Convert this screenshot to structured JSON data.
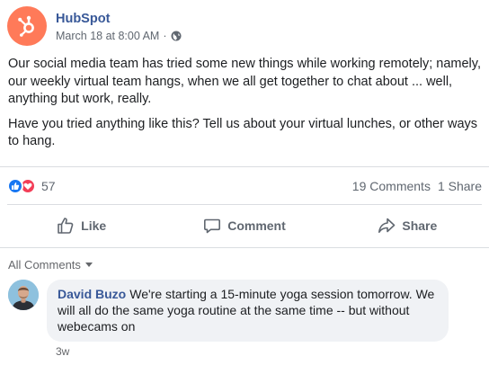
{
  "post": {
    "page_name": "HubSpot",
    "timestamp": "March 18 at 8:00 AM",
    "separator": "·",
    "privacy_icon": "globe-icon",
    "body_paragraph_1": "Our social media team has tried some new things while working remotely; namely, our weekly virtual team hangs, when we all get together to chat about ... well, anything but work, really.",
    "body_paragraph_2": "Have you tried anything like this? Tell us about your virtual lunches, or other ways to hang.",
    "brand_color": "#ff7a59"
  },
  "stats": {
    "reactions_count": "57",
    "reaction_icons": [
      "like-icon",
      "love-icon"
    ],
    "comments_count": "19 Comments",
    "shares_count": "1 Share"
  },
  "actions": {
    "like_label": "Like",
    "comment_label": "Comment",
    "share_label": "Share"
  },
  "comments_section": {
    "filter_label": "All Comments",
    "items": [
      {
        "author": "David Buzo",
        "text": "We're starting a 15-minute yoga session tomorrow. We will all do the same yoga routine at the same time -- but without webecams on",
        "age": "3w"
      }
    ]
  }
}
